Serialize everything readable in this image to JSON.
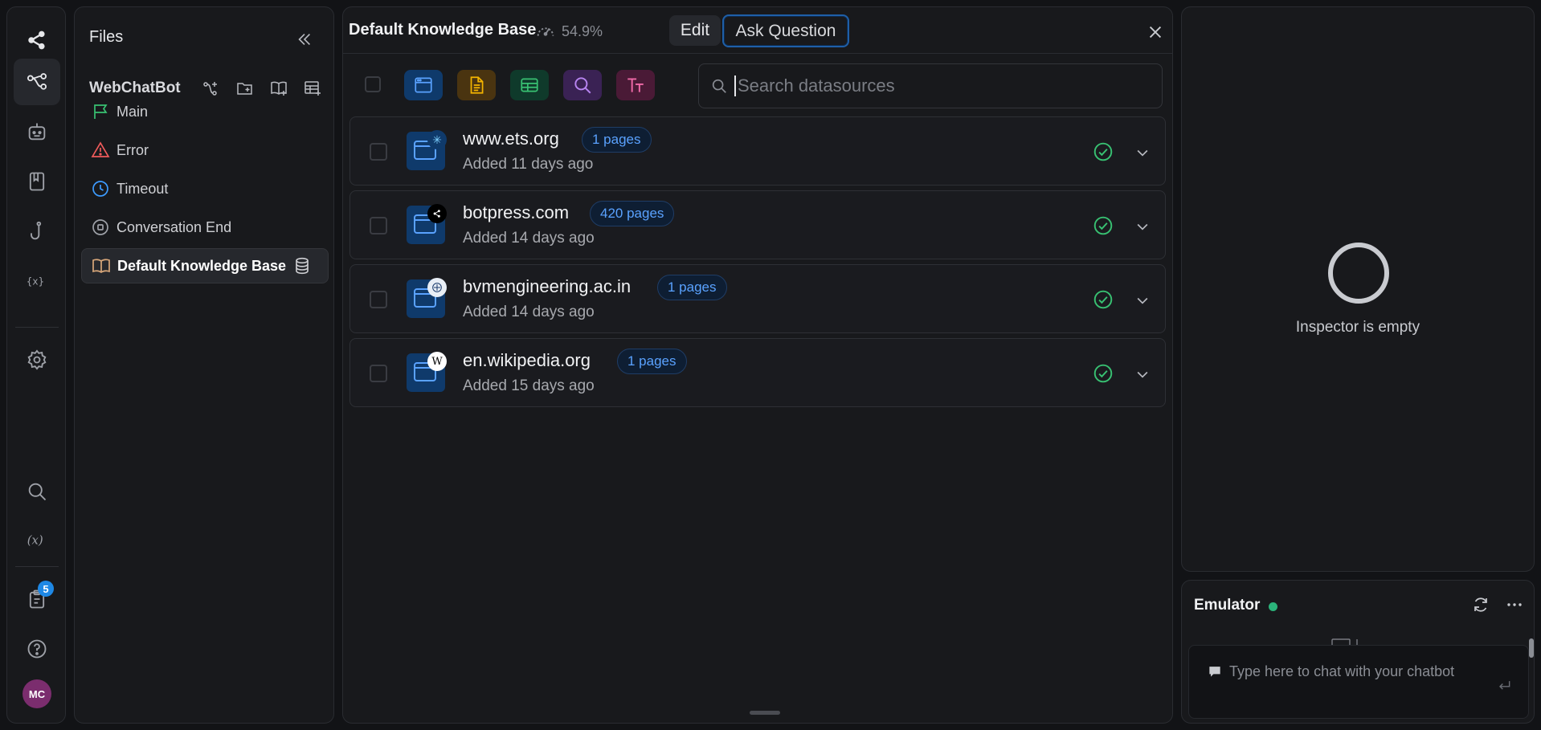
{
  "rail": {
    "badge_count": "5",
    "avatar_initials": "MC"
  },
  "files": {
    "title": "Files",
    "bot_name": "WebChatBot",
    "items": [
      {
        "label": "Main",
        "icon": "flag-icon"
      },
      {
        "label": "Error",
        "icon": "warning-icon"
      },
      {
        "label": "Timeout",
        "icon": "clock-icon"
      },
      {
        "label": "Conversation End",
        "icon": "stop-circle-icon"
      },
      {
        "label": "Default Knowledge Base",
        "icon": "book-open-icon",
        "active": true
      }
    ]
  },
  "kb": {
    "title": "Default Knowledge Base",
    "usage_percent": "54.9%",
    "edit_label": "Edit",
    "ask_label": "Ask Question",
    "search_placeholder": "Search datasources",
    "datasources": [
      {
        "name": "www.ets.org",
        "pages": "1 pages",
        "added": "Added 11 days ago",
        "status": "ok"
      },
      {
        "name": "botpress.com",
        "pages": "420 pages",
        "added": "Added 14 days ago",
        "status": "ok"
      },
      {
        "name": "bvmengineering.ac.in",
        "pages": "1 pages",
        "added": "Added 14 days ago",
        "status": "ok"
      },
      {
        "name": "en.wikipedia.org",
        "pages": "1 pages",
        "added": "Added 15 days ago",
        "status": "ok"
      }
    ]
  },
  "inspector": {
    "empty_text": "Inspector is empty"
  },
  "emulator": {
    "title": "Emulator",
    "input_placeholder": "Type here to chat with your chatbot"
  },
  "colors": {
    "accent_blue": "#1e88e5",
    "status_green": "#2bb37a",
    "avatar_purple": "#7b2d6e"
  }
}
